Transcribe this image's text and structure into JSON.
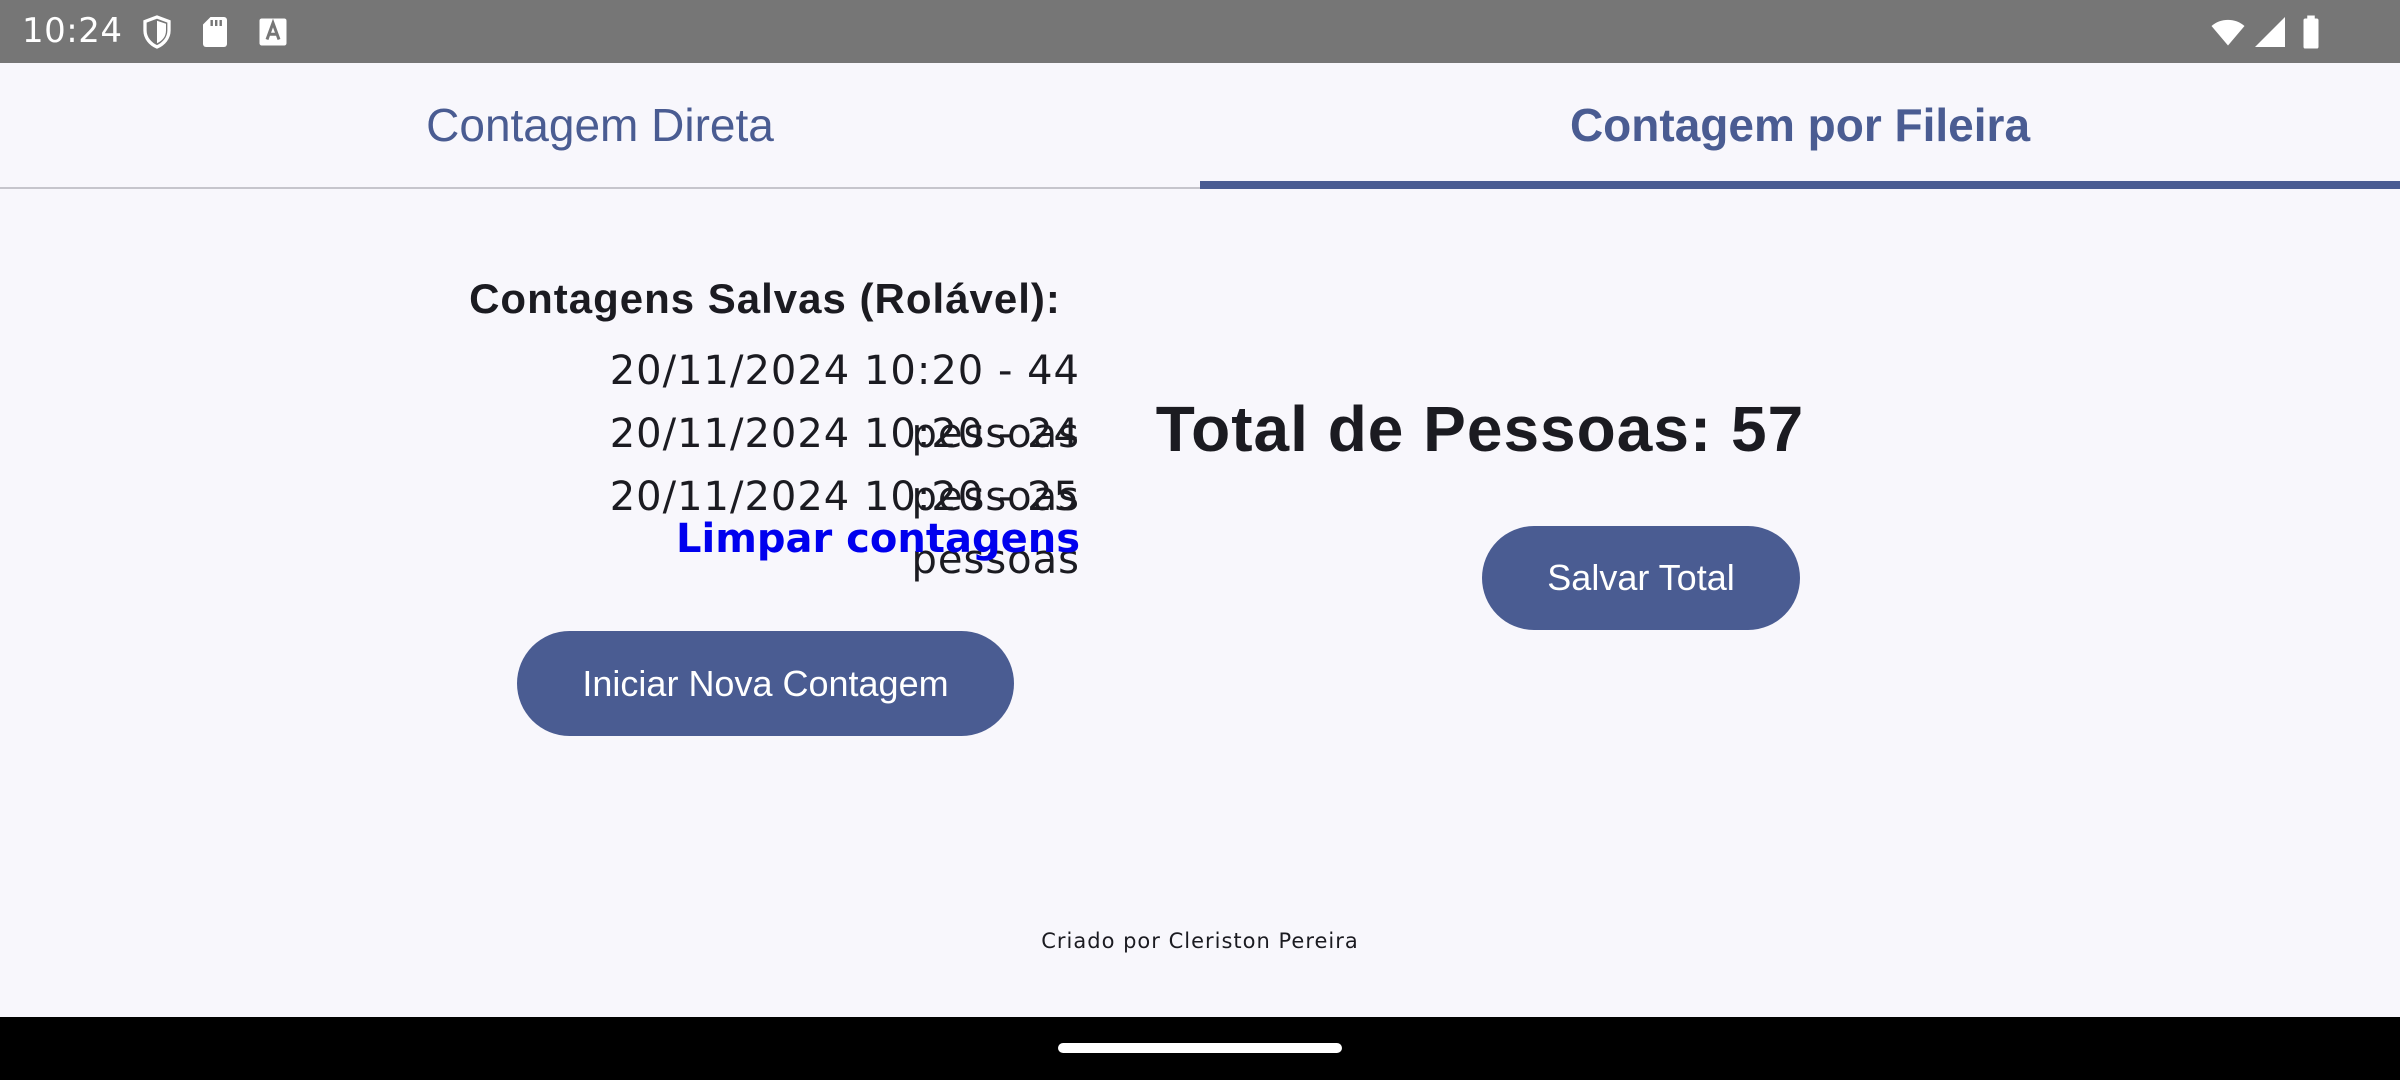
{
  "status_bar": {
    "time": "10:24",
    "left_icons": [
      "shield-icon",
      "sd-card-icon",
      "keyboard-a-icon"
    ],
    "right_icons": [
      "wifi-icon",
      "signal-icon",
      "battery-icon"
    ]
  },
  "tabs": [
    {
      "label": "Contagem Direta",
      "selected": false
    },
    {
      "label": "Contagem por Fileira",
      "selected": true
    }
  ],
  "saved_counts": {
    "title": "Contagens Salvas (Rolável):",
    "items": [
      "20/11/2024 10:20 - 44 pessoas",
      "20/11/2024 10:20 - 24 pessoas",
      "20/11/2024 10:20 - 25 pessoas"
    ],
    "clear_label": "Limpar contagens"
  },
  "new_count_button": "Iniciar Nova Contagem",
  "total": {
    "label": "Total de Pessoas: 57"
  },
  "save_total_button": "Salvar Total",
  "footer": "Criado por Cleriston Pereira",
  "colors": {
    "accent": "#4a5c92",
    "link": "#0000ee",
    "background": "#f8f7fc",
    "status_bar": "#767676"
  }
}
